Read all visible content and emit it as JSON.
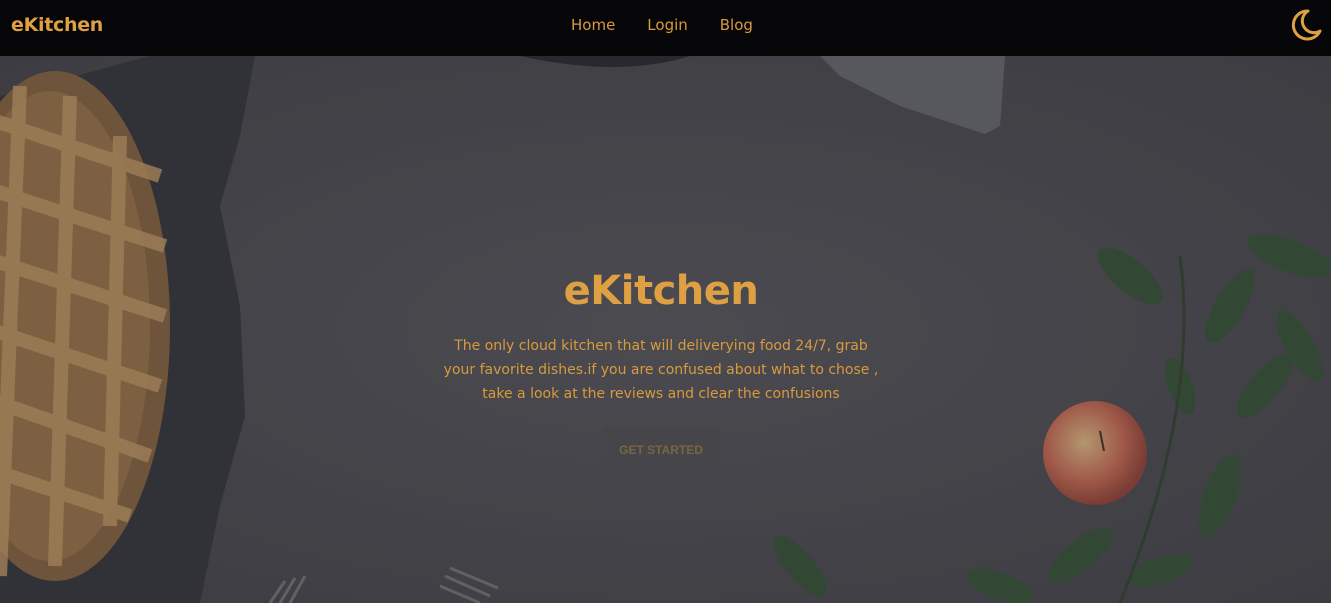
{
  "navbar": {
    "brand": "eKitchen",
    "links": [
      "Home",
      "Login",
      "Blog"
    ],
    "theme_toggle_icon": "moon-icon"
  },
  "hero": {
    "title": "eKitchen",
    "description": "The only cloud kitchen that will deliverying food 24/7, grab your favorite dishes.if you are confused about what to chose , take a look at the reviews and clear the confusions",
    "cta_label": "GET STARTED"
  },
  "colors": {
    "accent": "#dfa043",
    "navbar_bg": "#060609",
    "hero_bg": "#55555a"
  }
}
